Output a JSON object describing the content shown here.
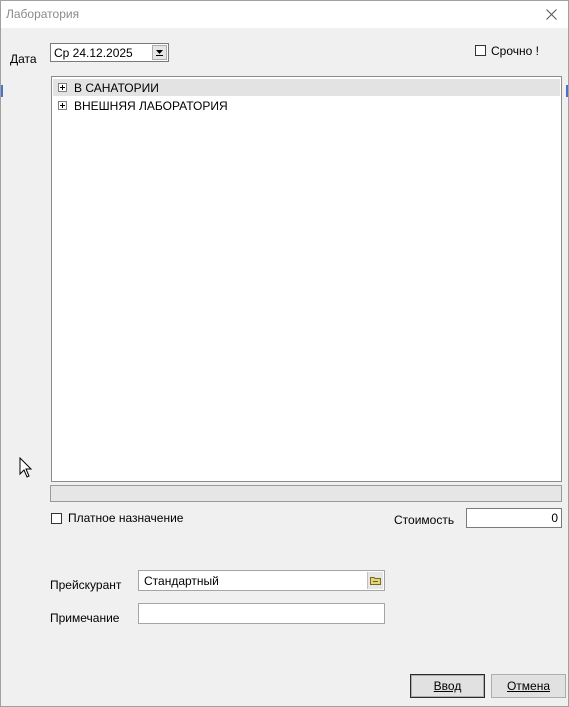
{
  "window": {
    "title": "Лаборатория"
  },
  "date": {
    "label": "Дата",
    "value": "Ср  24.12.2025"
  },
  "urgent": {
    "label": "Срочно !",
    "checked": false
  },
  "tree": {
    "items": [
      {
        "label": "В САНАТОРИИ",
        "selected": true
      },
      {
        "label": "ВНЕШНЯЯ ЛАБОРАТОРИЯ",
        "selected": false
      }
    ]
  },
  "paid": {
    "label": "Платное назначение",
    "checked": false
  },
  "cost": {
    "label": "Стоимость",
    "value": "0"
  },
  "pricelist": {
    "label": "Прейскурант",
    "value": "Стандартный"
  },
  "note": {
    "label": "Примечание",
    "value": ""
  },
  "buttons": {
    "ok": "Ввод",
    "cancel": "Отмена"
  },
  "colors": {
    "accent": "#4a73c8",
    "selection": "#e3e3e3"
  }
}
